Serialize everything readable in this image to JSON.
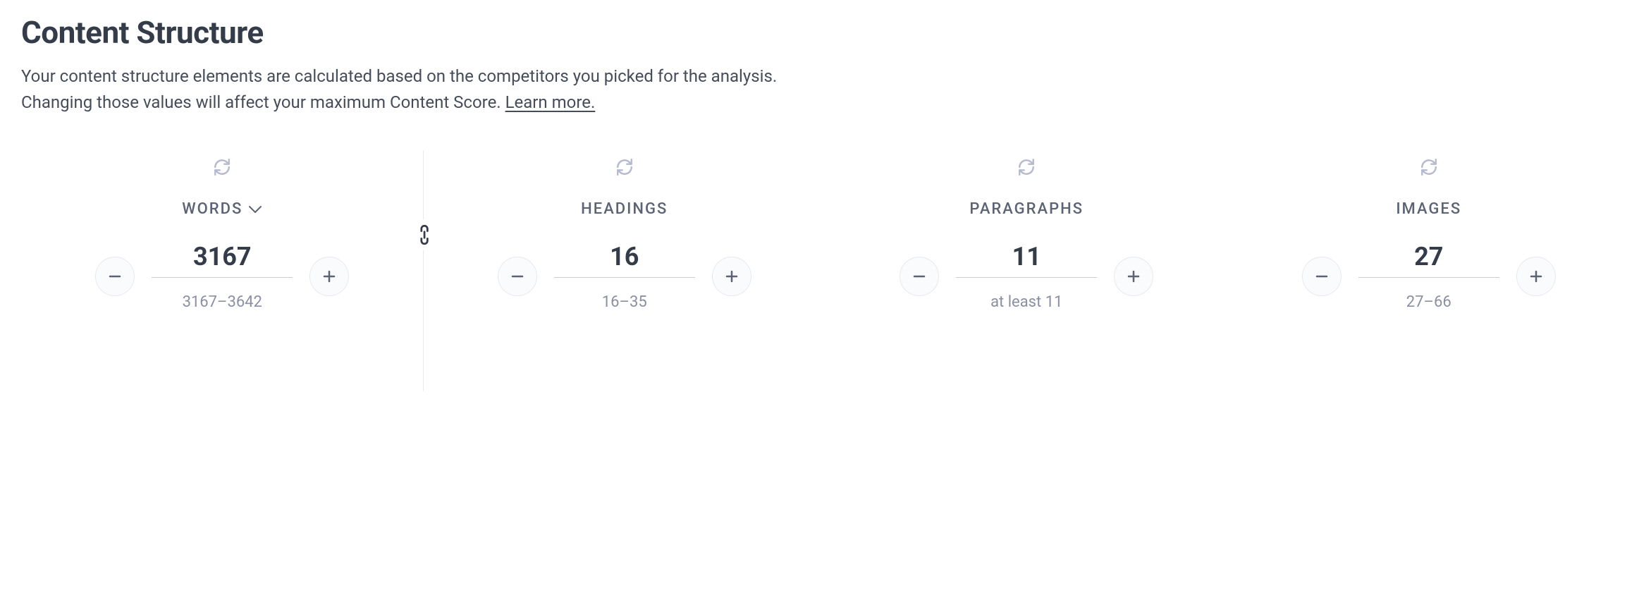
{
  "heading": "Content Structure",
  "description_line1": "Your content structure elements are calculated based on the competitors you picked for the analysis.",
  "description_line2": "Changing those values will affect your maximum Content Score. ",
  "learn_more_label": "Learn more.",
  "metrics": {
    "words": {
      "label": "WORDS",
      "value": "3167",
      "range": "3167–3642"
    },
    "headings": {
      "label": "HEADINGS",
      "value": "16",
      "range": "16–35"
    },
    "paragraphs": {
      "label": "PARAGRAPHS",
      "value": "11",
      "range": "at least 11"
    },
    "images": {
      "label": "IMAGES",
      "value": "27",
      "range": "27–66"
    }
  }
}
